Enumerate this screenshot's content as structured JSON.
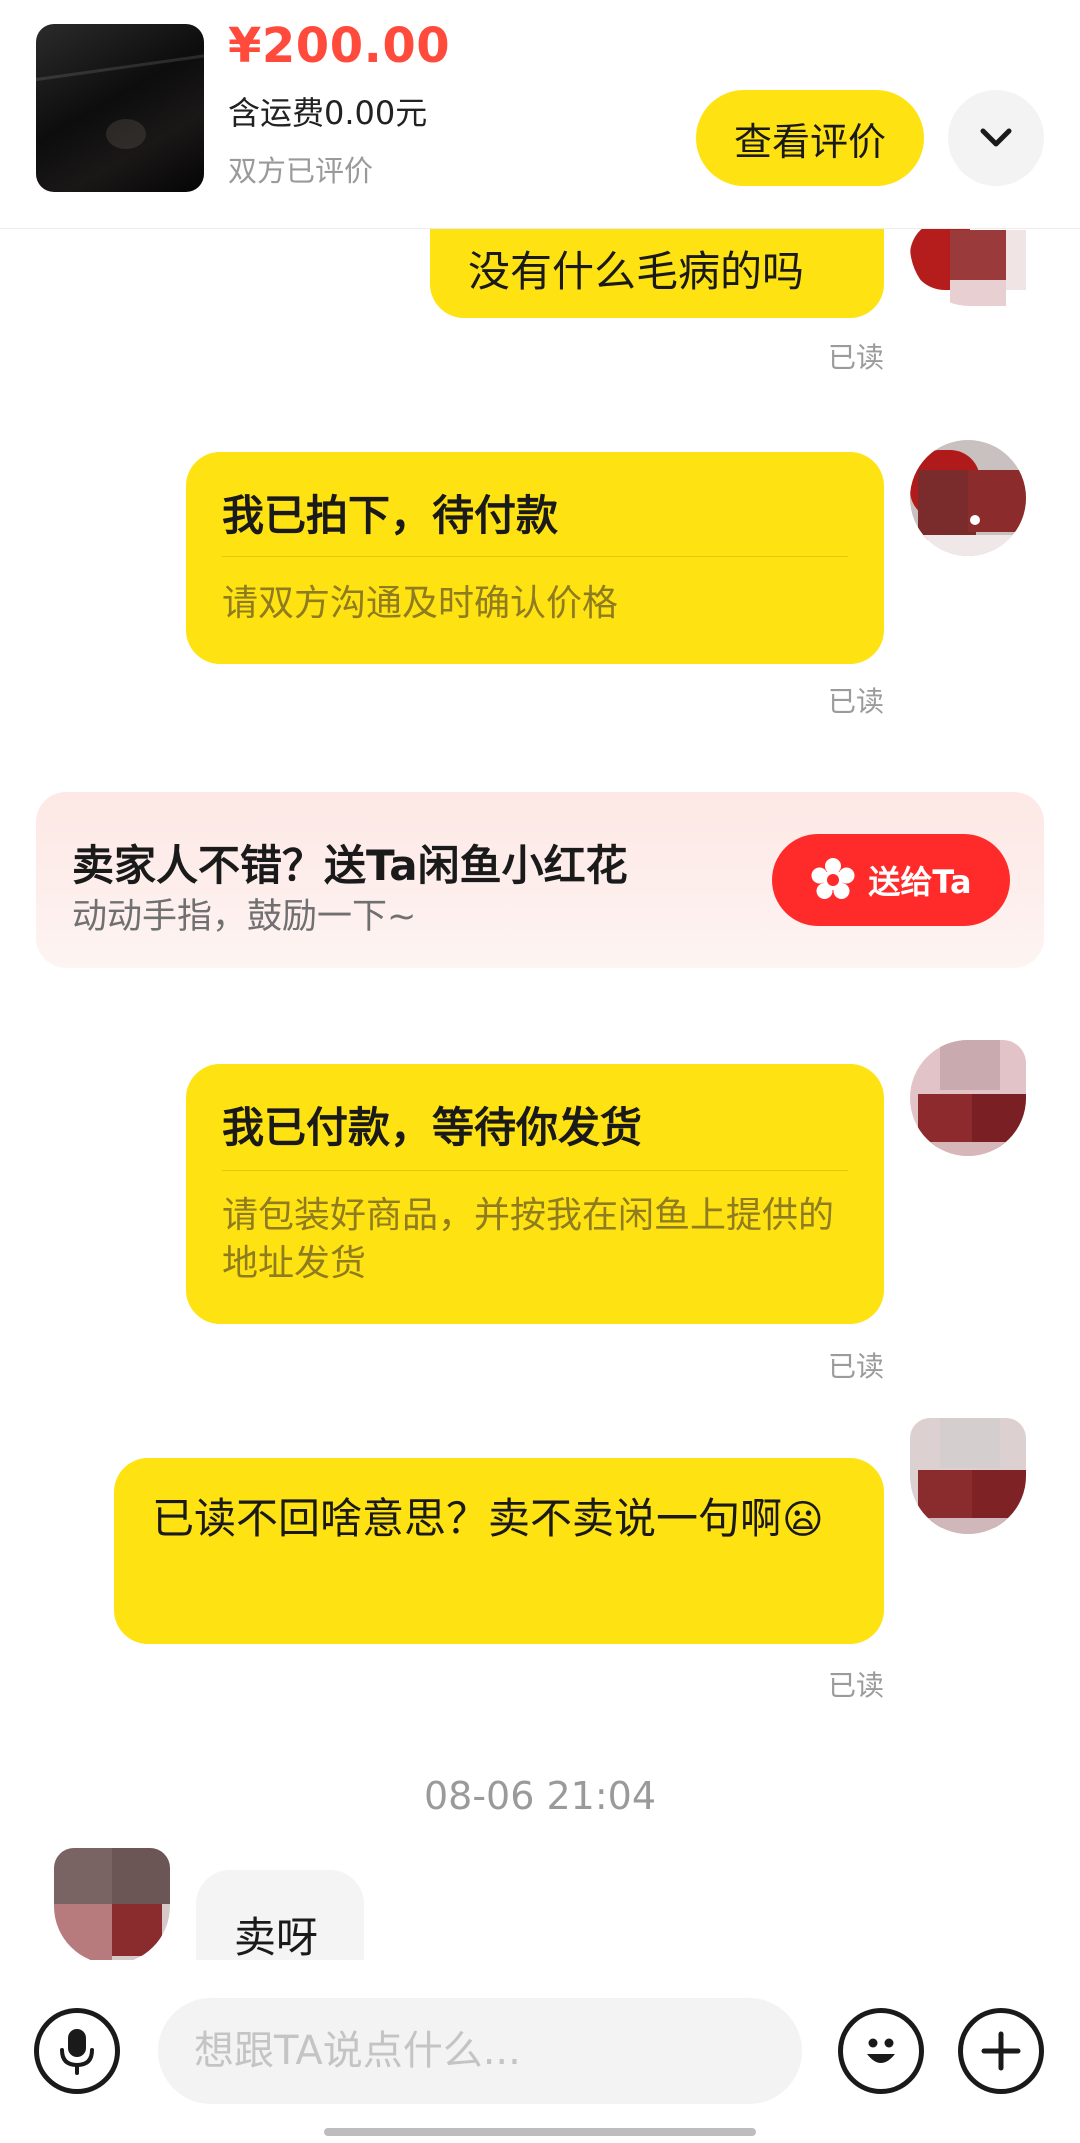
{
  "header": {
    "price": "¥200.00",
    "shipping": "含运费0.00元",
    "review_status": "双方已评价",
    "view_review_label": "查看评价",
    "collapse_icon": "chevron-down-icon"
  },
  "messages": [
    {
      "text": "没有什么毛病的吗",
      "read": "已读"
    },
    {
      "title": "我已拍下，待付款",
      "subtitle": "请双方沟通及时确认价格",
      "read": "已读"
    },
    {
      "title": "我已付款，等待你发货",
      "subtitle": "请包装好商品，并按我在闲鱼上提供的地址发货",
      "read": "已读"
    },
    {
      "text": "已读不回啥意思？卖不卖说一句啊",
      "emoji": "😦",
      "read": "已读"
    }
  ],
  "banner": {
    "title": "卖家人不错？送Ta闲鱼小红花",
    "subtitle": "动动手指，鼓励一下~",
    "button_label": "送给Ta",
    "button_icon": "flower-icon"
  },
  "timestamp": "08-06 21:04",
  "reply": {
    "text": "卖呀"
  },
  "input_bar": {
    "placeholder": "想跟TA说点什么...",
    "voice_icon": "microphone-icon",
    "emoji_icon": "smiley-icon",
    "plus_icon": "plus-icon"
  },
  "colors": {
    "accent_yellow": "#ffe211",
    "price_red": "#ff4a3c",
    "send_red": "#ff2b2b"
  }
}
